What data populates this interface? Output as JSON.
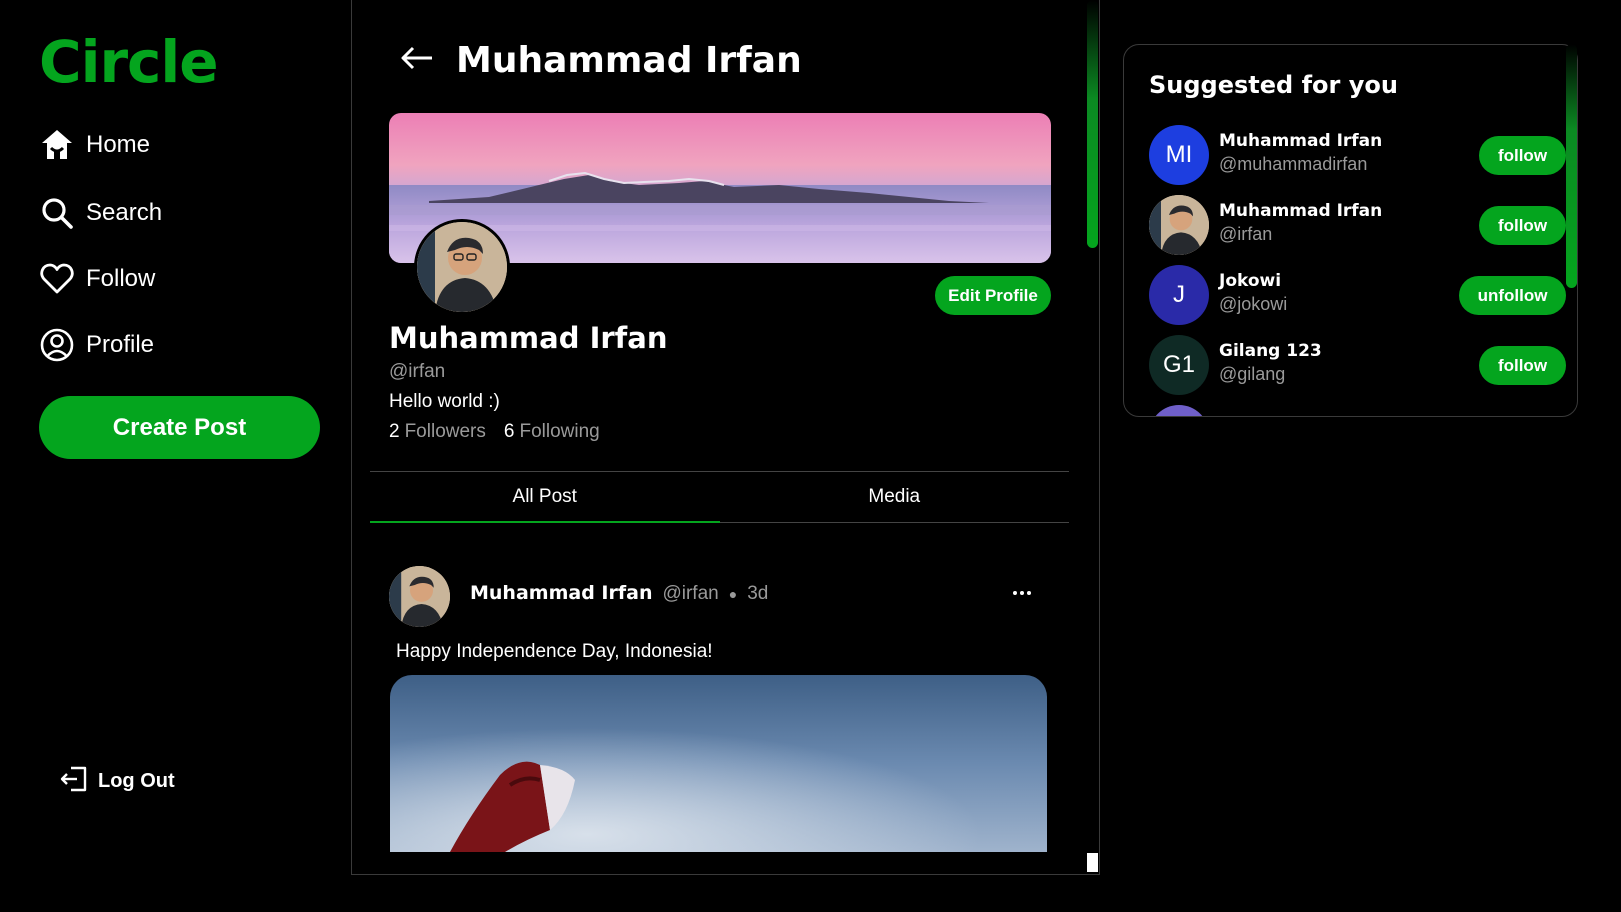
{
  "app": {
    "brand": "Circle",
    "accent_color": "#04a51e"
  },
  "sidebar": {
    "items": [
      {
        "label": "Home",
        "icon": "home-icon"
      },
      {
        "label": "Search",
        "icon": "search-icon"
      },
      {
        "label": "Follow",
        "icon": "heart-icon"
      },
      {
        "label": "Profile",
        "icon": "user-circle-icon"
      }
    ],
    "create_post": "Create Post",
    "logout": "Log Out"
  },
  "profile": {
    "header_title": "Muhammad Irfan",
    "name": "Muhammad Irfan",
    "handle": "@irfan",
    "bio": "Hello world :)",
    "followers_count": "2",
    "followers_label": "Followers",
    "following_count": "6",
    "following_label": "Following",
    "edit_button": "Edit Profile"
  },
  "tabs": [
    {
      "label": "All Post",
      "active": true
    },
    {
      "label": "Media",
      "active": false
    }
  ],
  "post": {
    "author": "Muhammad Irfan",
    "handle": "@irfan",
    "time": "3d",
    "text": "Happy Independence Day, Indonesia!"
  },
  "suggested": {
    "title": "Suggested for you",
    "users": [
      {
        "initials": "MI",
        "name": "Muhammad Irfan",
        "handle": "@muhammadirfan",
        "action": "follow",
        "avatar_color": "#1d3ee0"
      },
      {
        "initials": "",
        "name": "Muhammad Irfan",
        "handle": "@irfan",
        "action": "follow",
        "avatar_color": "#d8c9b3"
      },
      {
        "initials": "J",
        "name": "Jokowi",
        "handle": "@jokowi",
        "action": "unfollow",
        "avatar_color": "#2a2aa8"
      },
      {
        "initials": "G1",
        "name": "Gilang 123",
        "handle": "@gilang",
        "action": "follow",
        "avatar_color": "#0f2a25"
      }
    ]
  }
}
